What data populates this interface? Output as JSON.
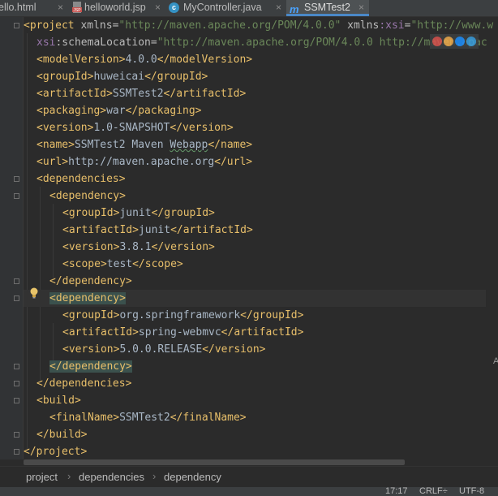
{
  "tabs": [
    {
      "label": "ello.html",
      "close": "×"
    },
    {
      "label": "helloworld.jsp",
      "close": "×"
    },
    {
      "label": "MyController.java",
      "close": "×"
    },
    {
      "label": "SSMTest2",
      "close": "×"
    }
  ],
  "code": {
    "l1": {
      "open": "<project ",
      "a1": "xmlns",
      "eq1": "=",
      "v1": "\"http://maven.apache.org/POM/4.0.0\"",
      "a2": " xmlns",
      "ns2": ":xsi",
      "eq2": "=",
      "v2": "\"http://www.w"
    },
    "l2": {
      "ns": "xsi",
      "a": ":schemaLocation",
      "eq": "=",
      "v": "\"http://maven.apache.org/POM/4.0.0 http://maven.apac"
    },
    "l3": {
      "o": "<modelVersion>",
      "t": "4.0.0",
      "c": "</modelVersion>"
    },
    "l4": {
      "o": "<groupId>",
      "t": "huweicai",
      "c": "</groupId>"
    },
    "l5": {
      "o": "<artifactId>",
      "t": "SSMTest2",
      "c": "</artifactId>"
    },
    "l6": {
      "o": "<packaging>",
      "t": "war",
      "c": "</packaging>"
    },
    "l7": {
      "o": "<version>",
      "t": "1.0-SNAPSHOT",
      "c": "</version>"
    },
    "l8": {
      "o": "<name>",
      "t1": "SSMTest2 Maven ",
      "t2": "Webapp",
      "c": "</name>"
    },
    "l9": {
      "o": "<url>",
      "t": "http://maven.apache.org",
      "c": "</url>"
    },
    "l10": {
      "o": "<dependencies>"
    },
    "l11": {
      "o": "<dependency>"
    },
    "l12": {
      "o": "<groupId>",
      "t": "junit",
      "c": "</groupId>"
    },
    "l13": {
      "o": "<artifactId>",
      "t": "junit",
      "c": "</artifactId>"
    },
    "l14": {
      "o": "<version>",
      "t": "3.8.1",
      "c": "</version>"
    },
    "l15": {
      "o": "<scope>",
      "t": "test",
      "c": "</scope>"
    },
    "l16": {
      "c": "</dependency>"
    },
    "l17": {
      "o": "<dependency>"
    },
    "l18": {
      "o": "<groupId>",
      "t": "org.springframework",
      "c": "</groupId>"
    },
    "l19": {
      "o": "<artifactId>",
      "t": "spring-webmvc",
      "c": "</artifactId>"
    },
    "l20": {
      "o": "<version>",
      "t": "5.0.0.RELEASE",
      "c": "</version>"
    },
    "l21": {
      "c": "</dependency>"
    },
    "l22": {
      "c": "</dependencies>"
    },
    "l23": {
      "o": "<build>"
    },
    "l24": {
      "o": "<finalName>",
      "t": "SSMTest2",
      "c": "</finalName>"
    },
    "l25": {
      "c": "</build>"
    },
    "l26": {
      "c": "</project>"
    }
  },
  "breadcrumb": {
    "items": [
      "project",
      "dependencies",
      "dependency"
    ],
    "separator": "›"
  },
  "status": {
    "position": "17:17",
    "line_sep": "CRLF÷",
    "encoding": "UTF-8"
  },
  "right_mark": "A",
  "icons": {
    "jsp": "jsp-file-icon",
    "class": "java-class-icon",
    "maven": "maven-icon",
    "bulb": "intention-bulb-icon"
  },
  "colors": {
    "background": "#2b2b2b",
    "tag": "#e8bf6a",
    "attribute_value": "#6a8759",
    "namespace": "#9876aa",
    "text": "#a9b7c6",
    "tab_accent": "#4a88c7"
  }
}
